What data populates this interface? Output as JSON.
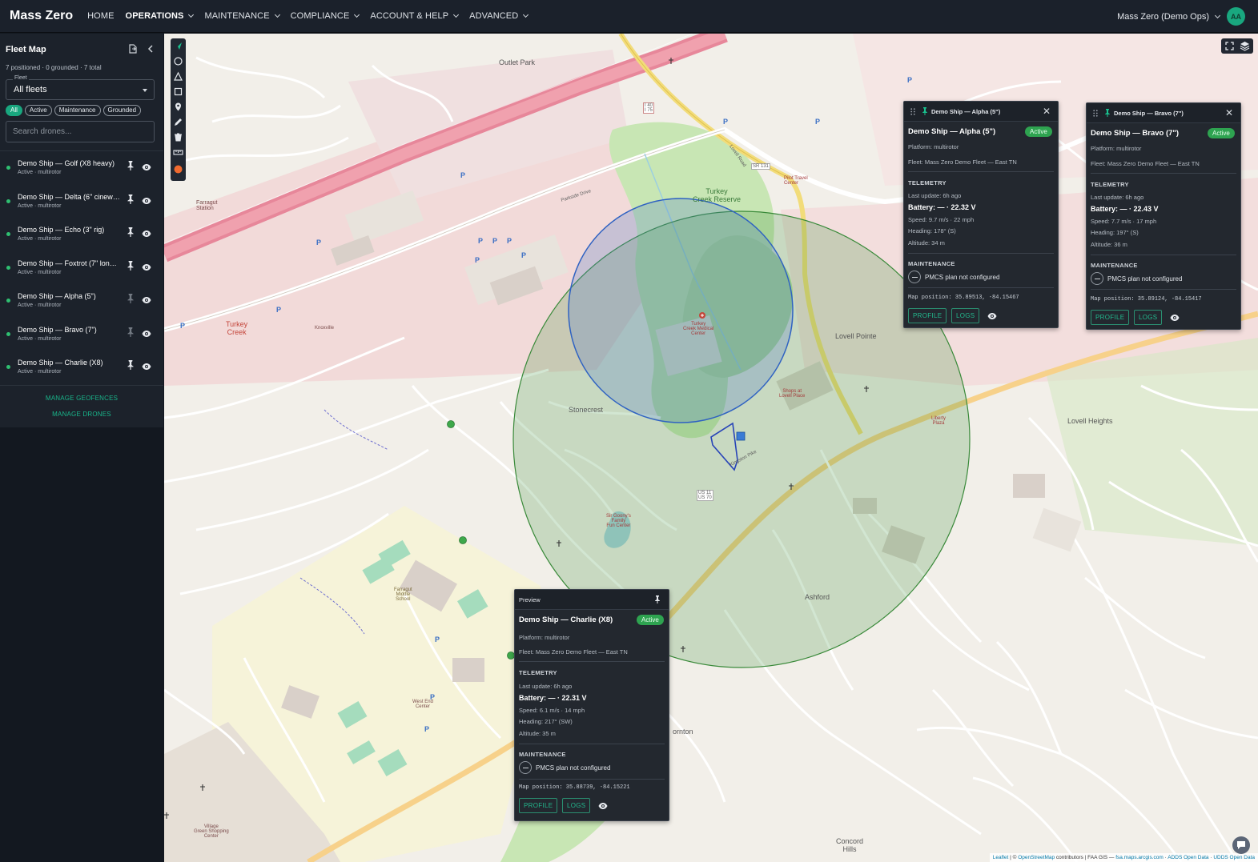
{
  "app": {
    "brand": "Mass Zero",
    "nav": [
      {
        "label": "HOME",
        "active": false,
        "dropdown": false
      },
      {
        "label": "OPERATIONS",
        "active": true,
        "dropdown": true
      },
      {
        "label": "MAINTENANCE",
        "active": false,
        "dropdown": true
      },
      {
        "label": "COMPLIANCE",
        "active": false,
        "dropdown": true
      },
      {
        "label": "ACCOUNT & HELP",
        "active": false,
        "dropdown": true
      },
      {
        "label": "ADVANCED",
        "active": false,
        "dropdown": true
      }
    ],
    "org": "Mass Zero (Demo Ops)",
    "avatar": "AA",
    "accent": "#19a77f"
  },
  "sidebar": {
    "title": "Fleet Map",
    "summary": "7 positioned · 0 grounded · 7 total",
    "fleet_label": "Fleet",
    "fleet_value": "All fleets",
    "filters": [
      "All",
      "Active",
      "Maintenance",
      "Grounded"
    ],
    "selected_filter": "All",
    "search_placeholder": "Search drones...",
    "drones": [
      {
        "name": "Demo Ship — Golf (X8 heavy)",
        "sub": "Active · multirotor",
        "pinned": true
      },
      {
        "name": "Demo Ship — Delta (6\" cinewhoop)",
        "sub": "Active · multirotor",
        "pinned": true
      },
      {
        "name": "Demo Ship — Echo (3\" rig)",
        "sub": "Active · multirotor",
        "pinned": true
      },
      {
        "name": "Demo Ship — Foxtrot (7\" long range)",
        "sub": "Active · multirotor",
        "pinned": true
      },
      {
        "name": "Demo Ship — Alpha (5\")",
        "sub": "Active · multirotor",
        "pinned": false
      },
      {
        "name": "Demo Ship — Bravo (7\")",
        "sub": "Active · multirotor",
        "pinned": false
      },
      {
        "name": "Demo Ship — Charlie (X8)",
        "sub": "Active · multirotor",
        "pinned": true
      }
    ],
    "manage_geofences": "MANAGE GEOFENCES",
    "manage_drones": "MANAGE DRONES"
  },
  "map": {
    "labels": {
      "outlet_park": "Outlet Park",
      "farragut_station": "Farragut\nStation",
      "turkey_creek": "Turkey\nCreek",
      "turkey_creek_reserve": "Turkey\nCreek Reserve",
      "stonecrest": "Stonecrest",
      "lovell_pointe": "Lovell Pointe",
      "lovell_heights": "Lovell Heights",
      "ashford": "Ashford",
      "concord_hills": "Concord\nHills",
      "farragut_middle": "Farragut\nMiddle\nSchool",
      "west_end_center": "West End\nCenter",
      "village_green": "Village\nGreen Shopping\nCenter",
      "medical_center": "Turkey\nCreek Medical\nCenter",
      "shops_lovell": "Shops at\nLovell Place",
      "liberty_plaza": "Liberty\nPlaza",
      "fun_center": "Sir Goony's\nFamily\nFun Center",
      "kingston_pike": "Kingston Pike",
      "parkside_drive": "Parkside Drive",
      "lovell_road": "Lovell Road",
      "i40_75": "I 40\nI 75",
      "sr131": "SR 131",
      "us11_70": "US 11\nUS 70",
      "thornton": "ornton",
      "knoxville": "Knoxville",
      "pilot": "Pilot Travel\nCenter"
    },
    "attribution": {
      "leaflet": "Leaflet",
      "osm": "OpenStreetMap",
      "rest": " contributors | FAA GIS — ",
      "faa": "fsa.maps.arcgis.com",
      "adds": "ADDS Open Data",
      "udds": "UDDS Open Data"
    }
  },
  "popups": {
    "preview": {
      "header": "Preview",
      "name": "Demo Ship — Charlie (X8)",
      "status": "Active",
      "platform": "Platform: multirotor",
      "fleet": "Fleet: Mass Zero Demo Fleet — East TN",
      "telemetry_title": "TELEMETRY",
      "last_update": "Last update: 6h ago",
      "battery": "Battery: — · 22.31 V",
      "speed": "Speed: 6.1 m/s · 14 mph",
      "heading": "Heading: 217° (SW)",
      "altitude": "Altitude: 35 m",
      "maint_title": "MAINTENANCE",
      "pmcs": "PMCS plan not configured",
      "map_position": "Map position: 35.88739, -84.15221",
      "profile": "PROFILE",
      "logs": "LOGS"
    },
    "alpha": {
      "header": "Demo Ship — Alpha (5\")",
      "name": "Demo Ship — Alpha (5\")",
      "status": "Active",
      "platform": "Platform: multirotor",
      "fleet": "Fleet: Mass Zero Demo Fleet — East TN",
      "telemetry_title": "TELEMETRY",
      "last_update": "Last update: 6h ago",
      "battery": "Battery: — · 22.32 V",
      "speed": "Speed: 9.7 m/s · 22 mph",
      "heading": "Heading: 178° (S)",
      "altitude": "Altitude: 34 m",
      "maint_title": "MAINTENANCE",
      "pmcs": "PMCS plan not configured",
      "map_position": "Map position: 35.89513, -84.15467",
      "profile": "PROFILE",
      "logs": "LOGS"
    },
    "bravo": {
      "header": "Demo Ship — Bravo (7\")",
      "name": "Demo Ship — Bravo (7\")",
      "status": "Active",
      "platform": "Platform: multirotor",
      "fleet": "Fleet: Mass Zero Demo Fleet — East TN",
      "telemetry_title": "TELEMETRY",
      "last_update": "Last update: 6h ago",
      "battery": "Battery: — · 22.43 V",
      "speed": "Speed: 7.7 m/s · 17 mph",
      "heading": "Heading: 197° (S)",
      "altitude": "Altitude: 36 m",
      "maint_title": "MAINTENANCE",
      "pmcs": "PMCS plan not configured",
      "map_position": "Map position: 35.89124, -84.15417",
      "profile": "PROFILE",
      "logs": "LOGS"
    }
  }
}
